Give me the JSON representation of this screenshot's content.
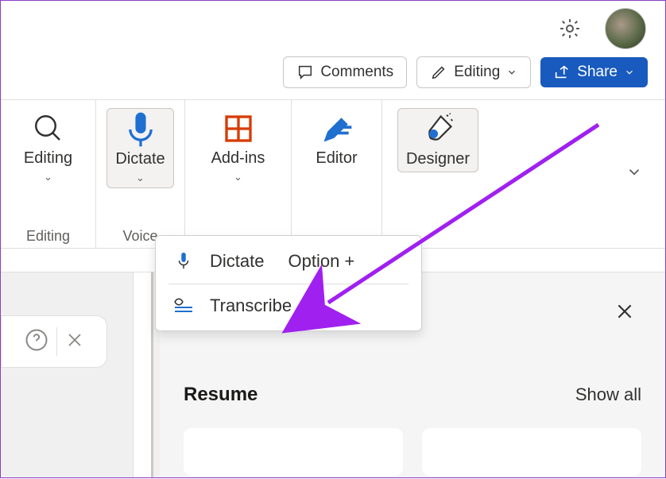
{
  "titlebar": {
    "settings_icon": "gear-icon"
  },
  "actions": {
    "comments": "Comments",
    "editing": "Editing",
    "share": "Share"
  },
  "ribbon": {
    "editing": {
      "label": "Editing",
      "group": "Editing"
    },
    "dictate": {
      "label": "Dictate",
      "group": "Voice"
    },
    "addins": {
      "label": "Add-ins"
    },
    "editor": {
      "label": "Editor"
    },
    "designer": {
      "label": "Designer"
    }
  },
  "dropdown": {
    "dictate": "Dictate",
    "dictate_shortcut": "Option +",
    "transcribe": "Transcribe"
  },
  "pane": {
    "resume": "Resume",
    "showall": "Show all"
  }
}
